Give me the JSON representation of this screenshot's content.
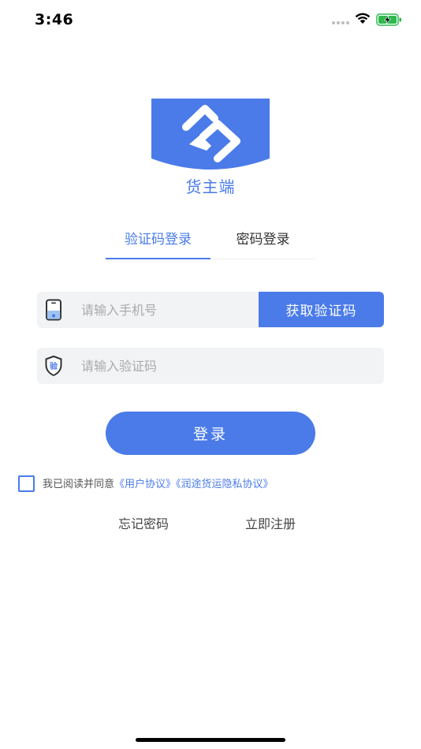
{
  "status_bar": {
    "time": "3:46"
  },
  "app": {
    "name": "货主端"
  },
  "tabs": [
    {
      "label": "验证码登录",
      "active": true
    },
    {
      "label": "密码登录",
      "active": false
    }
  ],
  "phone_field": {
    "placeholder": "请输入手机号",
    "value": ""
  },
  "get_code_button": {
    "label": "获取验证码"
  },
  "code_field": {
    "placeholder": "请输入验证码",
    "value": "",
    "icon_text": "验"
  },
  "login_button": {
    "label": "登录"
  },
  "agreement": {
    "checked": false,
    "prefix": "我已阅读并同意",
    "user_agreement": "《用户协议》",
    "privacy_policy": "《润途货运隐私协议》"
  },
  "links": {
    "forgot_password": "忘记密码",
    "register": "立即注册"
  },
  "colors": {
    "accent": "#4a7be9",
    "field_bg": "#f2f3f4"
  }
}
